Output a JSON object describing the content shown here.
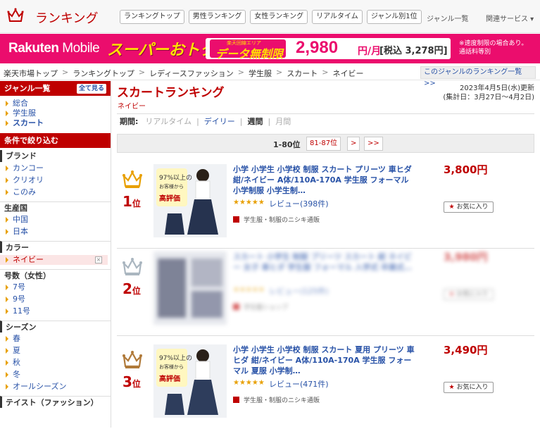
{
  "header": {
    "title": "ランキング",
    "tabs": [
      "ランキングトップ",
      "男性ランキング",
      "女性ランキング",
      "リアルタイム",
      "ジャンル別1位"
    ],
    "genre_list": "ジャンル一覧",
    "related": "関連サービス ▾"
  },
  "banner": {
    "brand_a": "Rakuten",
    "brand_b": " Mobile",
    "super": "スーパーおトク",
    "area": "楽天回線エリア",
    "data_unlimited": "データ無制限",
    "price": "2,980",
    "price_unit": "円/月",
    "tax": "[税込 3,278円]",
    "note1": "※速度制限の場合あり。",
    "note2": "通話料等別"
  },
  "breadcrumb": {
    "items": [
      "楽天市場トップ",
      "ランキングトップ",
      "レディースファッション",
      "学生服",
      "スカート",
      "ネイビー"
    ],
    "more": "このジャンルのランキング一覧 >>"
  },
  "sidebar": {
    "genre_head": "ジャンル一覧",
    "all_btn": "全て見る",
    "genres": [
      "総合",
      "学生服",
      "スカート"
    ],
    "filter_head": "条件で絞り込む",
    "brand_head": "ブランド",
    "brands": [
      "カンコー",
      "クリオリ",
      "このみ"
    ],
    "origin_head": "生産国",
    "origins": [
      "中国",
      "日本"
    ],
    "color_head": "カラー",
    "color_sel": "ネイビー",
    "remove": "×",
    "size_head": "号数（女性）",
    "sizes": [
      "7号",
      "9号",
      "11号"
    ],
    "season_head": "シーズン",
    "seasons": [
      "春",
      "夏",
      "秋",
      "冬",
      "オールシーズン"
    ],
    "taste_head": "テイスト（ファッション）"
  },
  "main": {
    "title": "スカートランキング",
    "subtitle": "ネイビー",
    "updated": "2023年4月5日(水)更新",
    "period_range": "(集計日：3月27日〜4月2日)",
    "period": {
      "label": "期間:",
      "realtime": "リアルタイム",
      "daily": "デイリー",
      "weekly": "週間",
      "monthly": "月間",
      "sep": "|"
    },
    "pagination": {
      "range": "1-80位",
      "next_range": "81-87位",
      "next": ">",
      "last": ">>"
    }
  },
  "items": [
    {
      "rank": "1",
      "rank_unit": "位",
      "crown": "gold",
      "name": "小学 小学生 小学校 制服 スカート プリーツ 車ヒダ 紺/ネイビー A体/110A-170A 学生服 フォーマル 小学制服 小学生制…",
      "stars": "★★★★★",
      "review": "レビュー(398件)",
      "shop": "学生服・制服のニシキ通販",
      "price": "3,800円",
      "fav": "お気に入り",
      "badge_a": "97%以上の",
      "badge_b": "お客様から",
      "badge_c": "高評価"
    },
    {
      "rank": "2",
      "rank_unit": "位",
      "crown": "silver",
      "name": "スカート 小学生 制服 プリーツ スカート 紺 ネイビー 女子 車ヒダ 学生服 フォーマル 入学式 卒業式…",
      "stars": "★★★★★",
      "review": "レビュー(125件)",
      "shop": "学生服ショップ",
      "price": "3,980円",
      "fav": "お気に入り",
      "badge_a": "",
      "badge_b": "",
      "badge_c": ""
    },
    {
      "rank": "3",
      "rank_unit": "位",
      "crown": "bronze",
      "name": "小学 小学生 小学校 制服 スカート 夏用 プリーツ 車ヒダ 紺/ネイビー A体/110A-170A 学生服 フォーマル 夏服 小学制…",
      "stars": "★★★★★",
      "review": "レビュー(471件)",
      "shop": "学生服・制服のニシキ通販",
      "price": "3,490円",
      "fav": "お気に入り",
      "badge_a": "97%以上の",
      "badge_b": "お客様から",
      "badge_c": "高評価"
    }
  ],
  "colors": {
    "accent": "#bf0000",
    "link": "#2852a7",
    "gold": "#e8a000",
    "silver": "#aab6c0",
    "bronze": "#b07a3a",
    "banner": "#eb0d6d"
  }
}
